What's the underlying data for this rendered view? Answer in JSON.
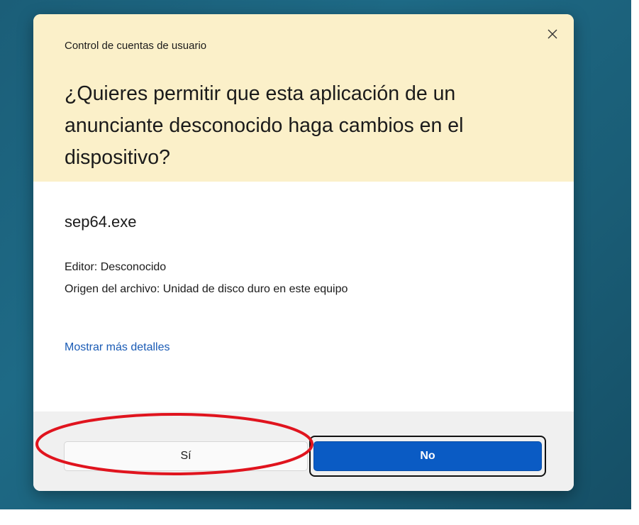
{
  "dialog": {
    "caption": "Control de cuentas de usuario",
    "question": "¿Quieres permitir que esta aplicación de un anunciante desconocido haga cambios en el dispositivo?",
    "app_name": "sep64.exe",
    "publisher": "Editor: Desconocido",
    "origin": "Origen del archivo: Unidad de disco duro en este equipo",
    "details_link": "Mostrar más detalles",
    "close_icon": "close-icon"
  },
  "buttons": {
    "yes_label": "Sí",
    "no_label": "No"
  },
  "annotation": {
    "shape": "ellipse",
    "target": "yes-button",
    "color": "#e0141e"
  },
  "colors": {
    "header_bg": "#fbf0c9",
    "primary_button": "#0a5bc4",
    "link": "#1a5bb5",
    "desktop_bg": "#1b5e78"
  }
}
